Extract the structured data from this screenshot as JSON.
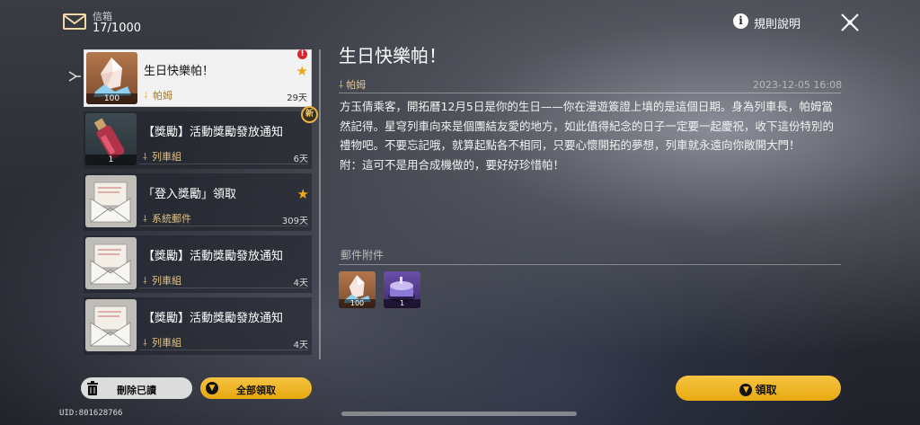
{
  "header": {
    "mail_title": "信箱",
    "mail_count": "17/1000",
    "rules_label": "規則說明"
  },
  "mail_list": [
    {
      "title": "生日快樂帕！",
      "sender": "帕姆",
      "days": "29天",
      "quantity": "100",
      "starred": true,
      "selected": true,
      "icon": "crystal-icon"
    },
    {
      "title": "【獎勵】活動獎勵發放通知",
      "sender": "列車組",
      "days": "6天",
      "quantity": "1",
      "badge": "新",
      "icon": "bottle-icon"
    },
    {
      "title": "「登入獎勵」領取",
      "sender": "系統郵件",
      "days": "309天",
      "starred": true,
      "icon": "envelope-icon"
    },
    {
      "title": "【獎勵】活動獎勵發放通知",
      "sender": "列車組",
      "days": "4天",
      "icon": "envelope-icon"
    },
    {
      "title": "【獎勵】活動獎勵發放通知",
      "sender": "列車組",
      "days": "4天",
      "icon": "envelope-icon"
    }
  ],
  "buttons": {
    "delete_read": "刪除已讀",
    "claim_all": "全部領取",
    "claim": "領取"
  },
  "uid": "UID:801628766",
  "detail": {
    "title": "生日快樂帕！",
    "sender": "帕姆",
    "date": "2023-12-05 16:08",
    "body_p1": "方玉倩乘客，開拓曆12月5日是你的生日——你在漫遊簽證上填的是這個日期。身為列車長，帕姆當然記得。星穹列車向來是個團結友愛的地方，如此值得紀念的日子一定要一起慶祝，收下這份特別的禮物吧。不要忘記哦，就算起點各不相同，只要心懷開拓的夢想，列車就永遠向你敞開大門！",
    "body_p2": "附：這可不是用合成機做的，要好好珍惜帕！",
    "attachments_label": "郵件附件",
    "attachments": [
      {
        "icon": "crystal-icon",
        "quantity": "100"
      },
      {
        "icon": "cake-icon",
        "quantity": "1"
      }
    ]
  },
  "colors": {
    "accent_gold": "#f0b22a",
    "sender_gold": "#e0c38b",
    "alert_red": "#d8262a"
  }
}
